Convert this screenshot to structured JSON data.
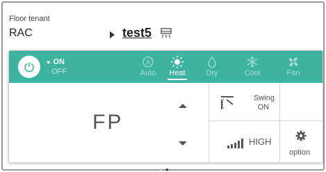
{
  "header": {
    "floor_label": "Floor tenant",
    "tenant_name": "RAC",
    "unit_name": "test5"
  },
  "power": {
    "on_label": "ON",
    "off_label": "OFF",
    "state": "on"
  },
  "modes": [
    {
      "label": "Auto",
      "icon": "auto-icon",
      "active": false
    },
    {
      "label": "Heat",
      "icon": "sun-icon",
      "active": true
    },
    {
      "label": "Dry",
      "icon": "droplet-icon",
      "active": false
    },
    {
      "label": "Cool",
      "icon": "snowflake-icon",
      "active": false
    },
    {
      "label": "Fan",
      "icon": "fan-icon",
      "active": false
    }
  ],
  "temperature": {
    "display": "FP"
  },
  "swing": {
    "line1": "Swing",
    "line2": "ON"
  },
  "fan_speed": {
    "label": "HIGH"
  },
  "option": {
    "label": "option"
  },
  "colors": {
    "accent": "#3eb3a0",
    "active_mode": "#ffffff",
    "inactive_mode": "#a9ddd3"
  }
}
